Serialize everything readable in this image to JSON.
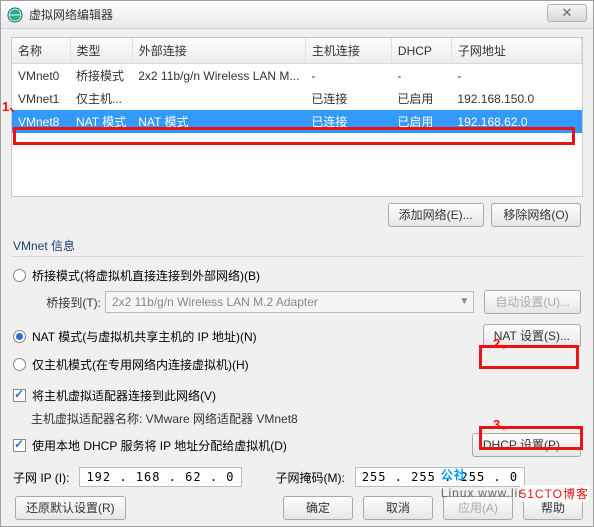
{
  "window": {
    "title": "虚拟网络编辑器"
  },
  "table": {
    "headers": {
      "name": "名称",
      "type": "类型",
      "ext": "外部连接",
      "host": "主机连接",
      "dhcp": "DHCP",
      "subnet": "子网地址"
    },
    "rows": [
      {
        "name": "VMnet0",
        "type": "桥接模式",
        "ext": "2x2 11b/g/n Wireless LAN M...",
        "host": "-",
        "dhcp": "-",
        "subnet": "-"
      },
      {
        "name": "VMnet1",
        "type": "仅主机...",
        "ext": "",
        "host": "已连接",
        "dhcp": "已启用",
        "subnet": "192.168.150.0"
      },
      {
        "name": "VMnet8",
        "type": "NAT 模式",
        "ext": "NAT 模式",
        "host": "已连接",
        "dhcp": "已启用",
        "subnet": "192.168.62.0"
      }
    ]
  },
  "buttons": {
    "add_net": "添加网络(E)...",
    "remove_net": "移除网络(O)",
    "auto_set": "自动设置(U)...",
    "nat_set": "NAT 设置(S)...",
    "dhcp_set": "DHCP 设置(P)...",
    "restore": "还原默认设置(R)",
    "ok": "确定",
    "cancel": "取消",
    "apply": "应用(A)",
    "help": "帮助"
  },
  "group": {
    "vmnet_info": "VMnet 信息"
  },
  "options": {
    "bridged": "桥接模式(将虚拟机直接连接到外部网络)(B)",
    "bridge_to_label": "桥接到(T):",
    "bridge_combo": "2x2 11b/g/n Wireless LAN M.2 Adapter",
    "nat": "NAT 模式(与虚拟机共享主机的 IP 地址)(N)",
    "hostonly": "仅主机模式(在专用网络内连接虚拟机)(H)",
    "connect_host": "将主机虚拟适配器连接到此网络(V)",
    "host_adapter_label": "主机虚拟适配器名称: VMware 网络适配器 VMnet8",
    "use_dhcp": "使用本地 DHCP 服务将 IP 地址分配给虚拟机(D)"
  },
  "fields": {
    "subnet_ip_label": "子网 IP (I):",
    "subnet_ip": "192 . 168 . 62 . 0",
    "mask_label": "子网掩码(M):",
    "mask": "255 . 255 . 255 . 0"
  },
  "markers": {
    "m1": "1、",
    "m2": "2、",
    "m3": "3、"
  },
  "watermark": {
    "big": "公社",
    "line": "Linux",
    "url": "www.linuxidc.com",
    "cto": "51CTO博客"
  }
}
